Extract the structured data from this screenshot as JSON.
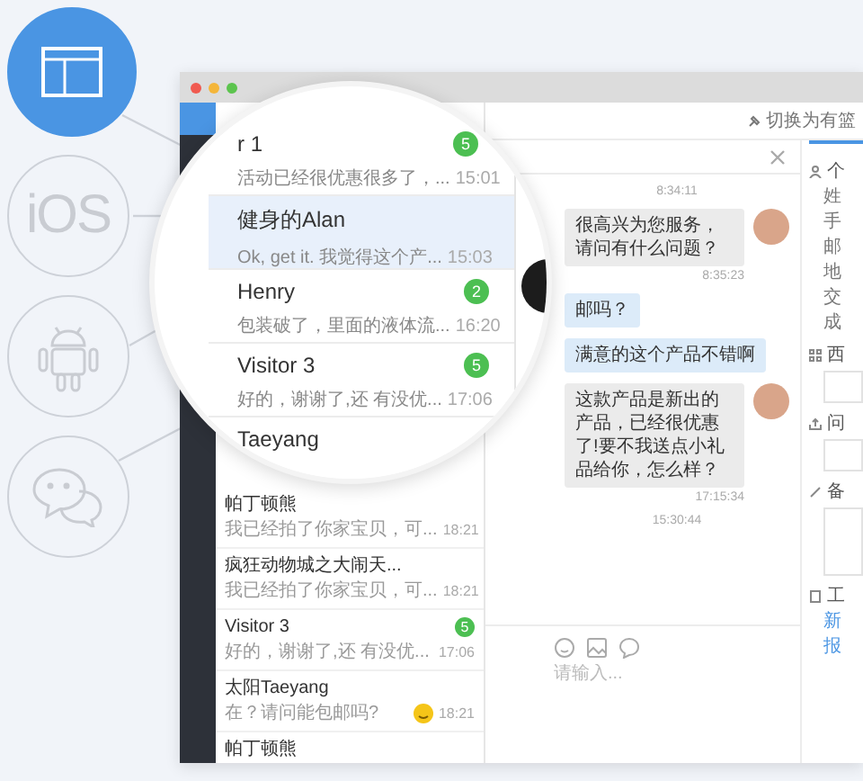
{
  "platforms": [
    {
      "kind": "web",
      "selected": true
    },
    {
      "kind": "ios",
      "label": "iOS",
      "selected": false
    },
    {
      "kind": "android",
      "selected": false
    },
    {
      "kind": "wechat",
      "selected": false
    }
  ],
  "magnifier": {
    "conversations": [
      {
        "name": "r 1",
        "preview": "活动已经很优惠很多了，...",
        "time": "15:01",
        "badge": "5",
        "selected": false
      },
      {
        "name": "健身的Alan",
        "preview": "Ok, get it. 我觉得这个产...",
        "time": "15:03",
        "selected": true
      },
      {
        "name": "Henry",
        "preview": "包装破了，里面的液体流...",
        "time": "16:20",
        "badge": "2",
        "selected": false
      },
      {
        "name": "Visitor 3",
        "preview": "好的，谢谢了,还 有没优...",
        "time": "17:06",
        "badge": "5",
        "selected": false
      },
      {
        "name": "Taeyang",
        "selected": false
      }
    ]
  },
  "conversations": [
    {
      "name": "帕丁顿熊",
      "preview": "我已经拍了你家宝贝，可...",
      "time": "18:21"
    },
    {
      "name": "疯狂动物城之大闹天...",
      "preview": "我已经拍了你家宝贝，可...",
      "time": "18:21"
    },
    {
      "name": "Visitor 3",
      "preview": "好的，谢谢了,还 有没优...",
      "time": "17:06",
      "badge": "5"
    },
    {
      "name": "太阳Taeyang",
      "preview": "在？请问能包邮吗?",
      "time": "18:21",
      "emoji": true
    },
    {
      "name": "帕丁顿熊"
    }
  ],
  "chat": {
    "mode_label": "切换为有篮",
    "messages": [
      {
        "kind": "time",
        "text": "8:34:11"
      },
      {
        "kind": "out",
        "text": "很高兴为您服务，请问有什么问题？",
        "time": "8:35:23"
      },
      {
        "kind": "in",
        "text": "邮吗？"
      },
      {
        "kind": "in",
        "text": "满意的这个产品不错啊"
      },
      {
        "kind": "out",
        "text": "这款产品是新出的产品，已经很优惠了!要不我送点小礼品给你，怎么样？",
        "time": "17:15:34"
      },
      {
        "kind": "time",
        "text": "15:30:44"
      }
    ],
    "input": {
      "placeholder": "请输入..."
    }
  },
  "side_panel": [
    {
      "kind": "rows",
      "title": "个",
      "rows": [
        "姓",
        "手",
        "邮",
        "地",
        "交",
        "成"
      ]
    },
    {
      "kind": "box",
      "title": "西"
    },
    {
      "kind": "box",
      "title": "问"
    },
    {
      "kind": "tallbox",
      "title": "备"
    },
    {
      "kind": "links",
      "title": "工",
      "links": [
        "新",
        "报"
      ]
    }
  ]
}
